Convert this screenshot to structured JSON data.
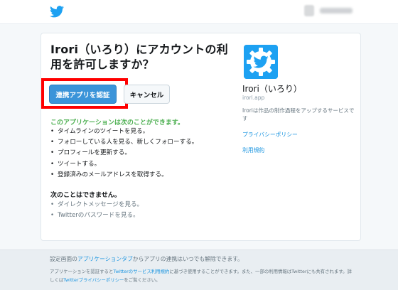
{
  "header": {
    "logo_icon": "twitter-bird-icon",
    "brand_color": "#1da1f2"
  },
  "auth": {
    "title": "Irori（いろり）にアカウントの利用を許可しますか？",
    "authorize_label": "連携アプリを認証",
    "cancel_label": "キャンセル",
    "highlight_color": "#ff0000",
    "can_heading": "このアプリケーションは次のことができます。",
    "can_items": [
      "タイムラインのツイートを見る。",
      "フォローしている人を見る、新しくフォローする。",
      "プロフィールを更新する。",
      "ツイートする。",
      "登録済みのメールアドレスを取得する。"
    ],
    "cannot_heading": "次のことはできません。",
    "cannot_items": [
      "ダイレクトメッセージを見る。",
      "Twitterのパスワードを見る。"
    ]
  },
  "app": {
    "icon": "gear-bird-icon",
    "name": "Irori（いろり）",
    "url": "irori.app",
    "description": "Iroriは作品の制作過程をアップするサービスです",
    "privacy_label": "プライバシーポリシー",
    "terms_label": "利用規約"
  },
  "footer": {
    "line1_pre": "設定画面の",
    "line1_link": "アプリケーションタブ",
    "line1_post": "からアプリの連携はいつでも解除できます。",
    "line2_pre": "アプリケーションを認証すると",
    "line2_link": "Twitterのサービス利用規約",
    "line2_post": "に基づき使用することができます。また、一部の利用情報はTwitterにも共有されます。詳",
    "line3_pre": "しくは",
    "line3_link": "Twitterプライバシーポリシー",
    "line3_post": "をご覧ください。"
  }
}
